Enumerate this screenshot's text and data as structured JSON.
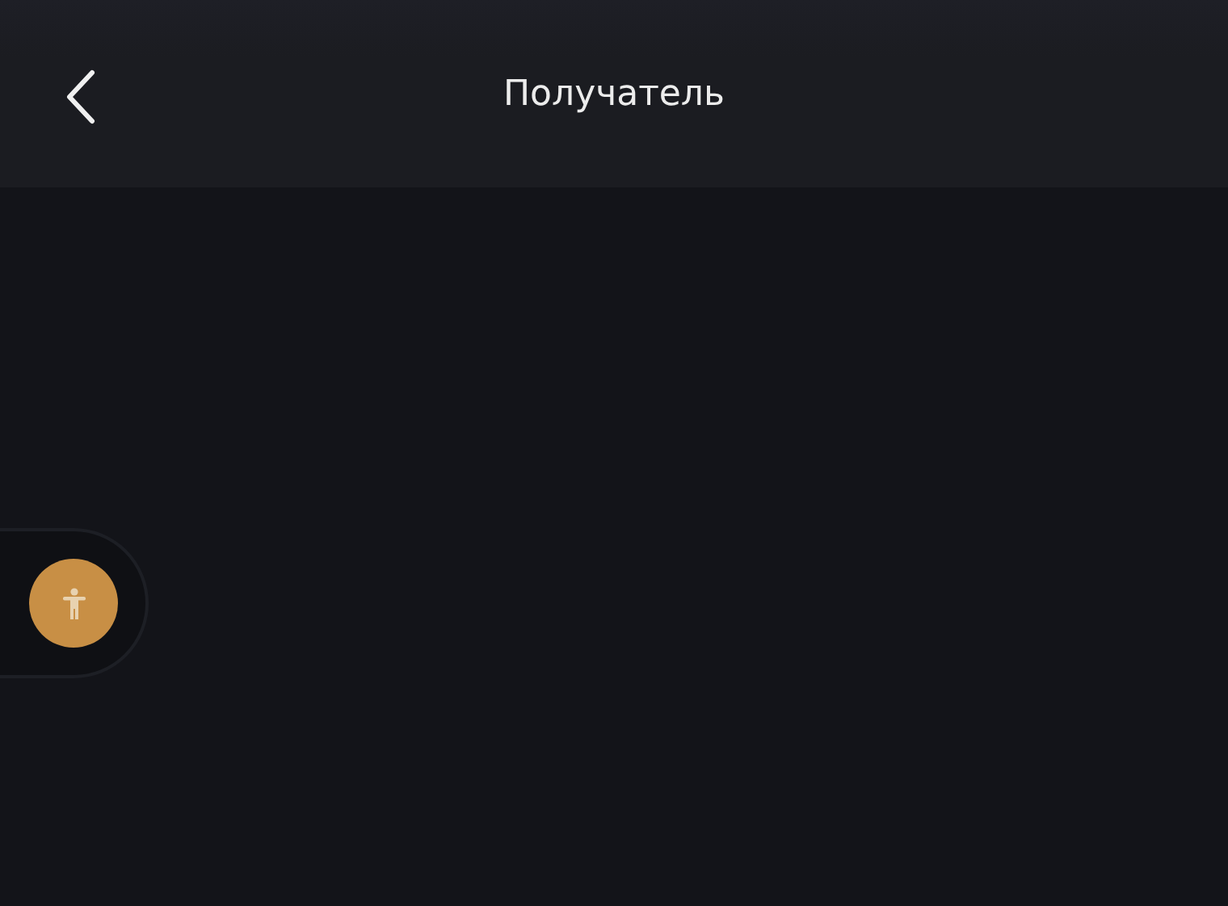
{
  "header": {
    "title": "Получатель"
  }
}
